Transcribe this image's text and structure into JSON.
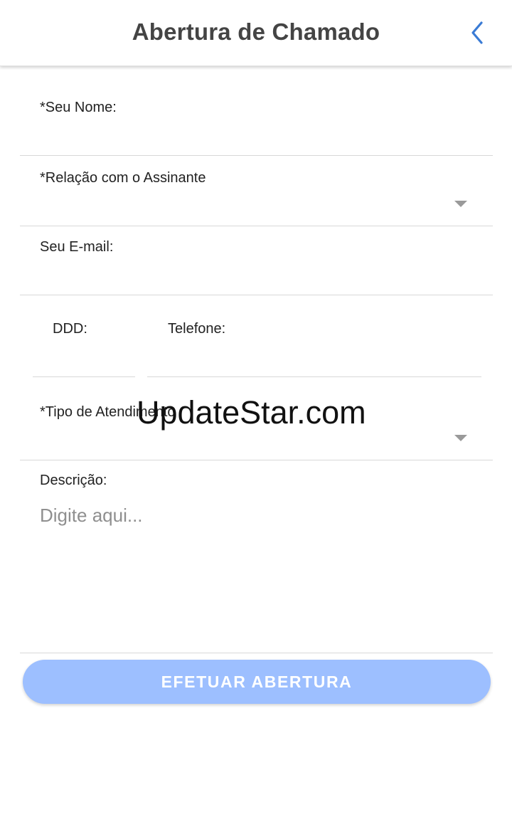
{
  "header": {
    "title": "Abertura de Chamado",
    "back_icon": "chevron-left-icon",
    "accent_color": "#3a7bd5"
  },
  "form": {
    "name_label": "*Seu Nome:",
    "name_value": "",
    "relation_label": "*Relação com o Assinante",
    "relation_value": "",
    "email_label": "Seu E-mail:",
    "email_value": "",
    "ddd_label": "DDD:",
    "ddd_value": "",
    "phone_label": "Telefone:",
    "phone_value": "",
    "service_type_label": "*Tipo de Atendimento",
    "service_type_value": "",
    "description_label": "Descrição:",
    "description_placeholder": "Digite aqui...",
    "dropdown_icon": "caret-down-icon"
  },
  "actions": {
    "submit_label": "EFETUAR ABERTURA",
    "submit_color": "#9dbfff"
  },
  "overlay": {
    "watermark": "UpdateStar.com"
  }
}
